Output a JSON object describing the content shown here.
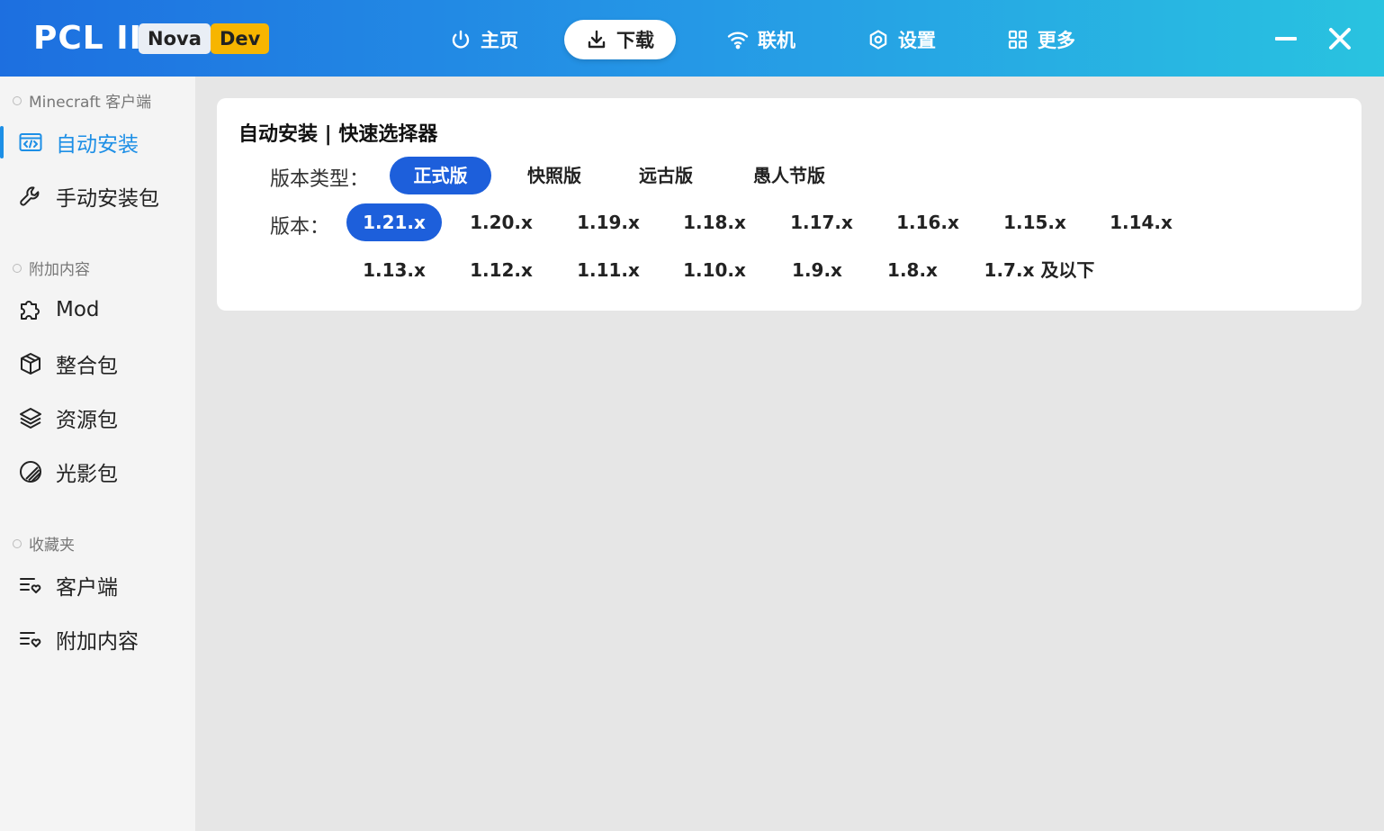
{
  "app": {
    "logo": "PCL II",
    "badge_nova": "Nova",
    "badge_dev": "Dev"
  },
  "nav": {
    "home": "主页",
    "download": "下载",
    "multiplayer": "联机",
    "settings": "设置",
    "more": "更多"
  },
  "sidebar": {
    "section_client": "Minecraft 客户端",
    "auto_install": "自动安装",
    "manual_install": "手动安装包",
    "section_addons": "附加内容",
    "mod": "Mod",
    "modpack": "整合包",
    "resourcepack": "资源包",
    "shaderpack": "光影包",
    "section_favorites": "收藏夹",
    "fav_client": "客户端",
    "fav_addons": "附加内容"
  },
  "card": {
    "title": "自动安装 | 快速选择器",
    "type_label": "版本类型：",
    "types": [
      "正式版",
      "快照版",
      "远古版",
      "愚人节版"
    ],
    "version_label": "版本：",
    "versions": [
      "1.21.x",
      "1.20.x",
      "1.19.x",
      "1.18.x",
      "1.17.x",
      "1.16.x",
      "1.15.x",
      "1.14.x",
      "1.13.x",
      "1.12.x",
      "1.11.x",
      "1.10.x",
      "1.9.x",
      "1.8.x",
      "1.7.x 及以下"
    ]
  },
  "colors": {
    "accent": "#1d5fdb",
    "sidebar_active": "#1d8fe6",
    "titlebar_start": "#1d6fe0",
    "titlebar_end": "#29c3e0"
  },
  "icons": {
    "home": "power-icon",
    "download": "download-icon",
    "multiplayer": "wifi-icon",
    "settings": "gear-icon",
    "more": "grid-icon"
  }
}
